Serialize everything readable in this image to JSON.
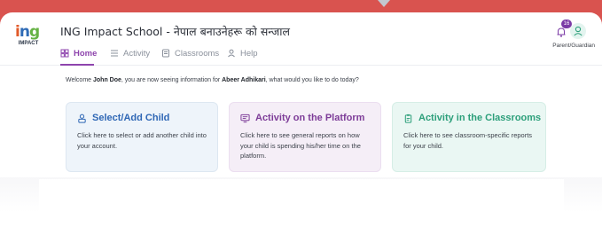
{
  "app": {
    "logo_mark": "ing",
    "logo_sub": "IMPACT",
    "title": "ING Impact School - नेपाल बनाउनेहरू को सन्जाल"
  },
  "nav": {
    "items": [
      {
        "label": "Home",
        "icon": "home-icon",
        "active": true
      },
      {
        "label": "Activity",
        "icon": "list-icon",
        "active": false
      },
      {
        "label": "Classrooms",
        "icon": "book-icon",
        "active": false
      },
      {
        "label": "Help",
        "icon": "person-icon",
        "active": false
      }
    ]
  },
  "header": {
    "notification_count": "16",
    "role": "Parent/Guardian"
  },
  "welcome": {
    "prefix": "Welcome ",
    "user": "John Doe",
    "middle": ", you are now seeing information for ",
    "child": "Abeer Adhikari",
    "suffix": ", what would you like to do today?"
  },
  "cards": [
    {
      "title": "Select/Add Child",
      "description": "Click here to select or add another child into your account.",
      "color": "#2f67b5"
    },
    {
      "title": "Activity on the Platform",
      "description": "Click here to see general reports on how your child is spending his/her time on the platform.",
      "color": "#7d3c98"
    },
    {
      "title": "Activity in the Classrooms",
      "description": "Click here to see classroom-specific reports for your child.",
      "color": "#2c9f7a"
    }
  ],
  "colors": {
    "accent": "#8e44ad",
    "background": "#d9534f"
  }
}
